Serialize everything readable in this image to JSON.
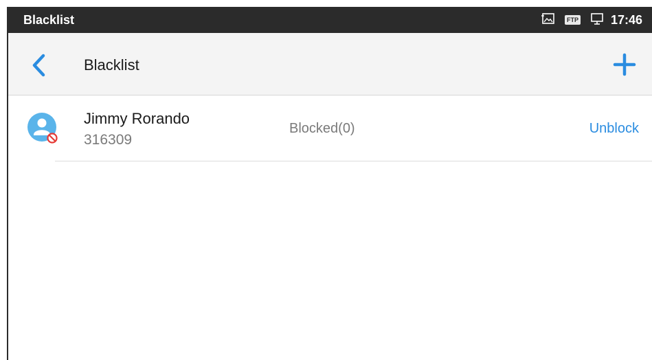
{
  "status_bar": {
    "title": "Blacklist",
    "ftp_badge": "FTP",
    "time": "17:46",
    "icons": [
      "screenshot-icon",
      "ftp-icon",
      "display-icon"
    ]
  },
  "app_bar": {
    "back_icon": "back-chevron-icon",
    "title": "Blacklist",
    "add_icon": "plus-icon"
  },
  "blacklist": [
    {
      "name": "Jimmy Rorando",
      "number": "316309",
      "status": "Blocked(0)",
      "action": "Unblock",
      "avatar_icon": "contact-blocked-icon"
    }
  ],
  "colors": {
    "status_bar_bg": "#2b2b2b",
    "app_bar_bg": "#f4f4f4",
    "accent": "#2a8ce0",
    "avatar": "#5ab4ea",
    "blocked_badge": "#e53935"
  }
}
